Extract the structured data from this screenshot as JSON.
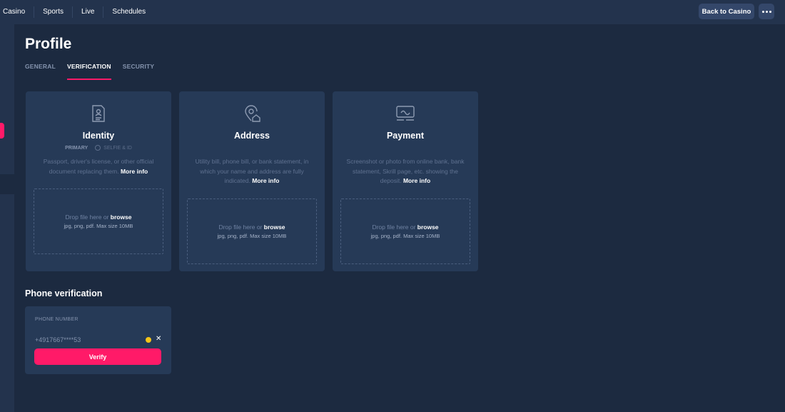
{
  "topnav": {
    "items": [
      "Casino",
      "Sports",
      "Live",
      "Schedules"
    ],
    "back_label": "Back to Casino"
  },
  "profile": {
    "title": "Profile",
    "tabs": [
      "GENERAL",
      "VERIFICATION",
      "SECURITY"
    ],
    "active_tab": "VERIFICATION"
  },
  "cards": [
    {
      "title": "Identity",
      "icon": "id-document-icon",
      "badge_primary": "PRIMARY",
      "badge_secondary": "SELFIE & ID",
      "desc": "Passport, driver's license, or other official document replacing them.",
      "more": "More info",
      "drop_text": "Drop file here or",
      "browse": "browse",
      "hint": "jpg, png, pdf. Max size 10MB"
    },
    {
      "title": "Address",
      "icon": "location-home-icon",
      "desc": "Utility bill, phone bill, or bank statement, in which your name and address are fully indicated.",
      "more": "More info",
      "drop_text": "Drop file here or",
      "browse": "browse",
      "hint": "jpg, png, pdf. Max size 10MB"
    },
    {
      "title": "Payment",
      "icon": "payment-card-icon",
      "desc": "Screenshot or photo from online bank, bank statement, Skrill page, etc. showing the deposit.",
      "more": "More info",
      "drop_text": "Drop file here or",
      "browse": "browse",
      "hint": "jpg, png, pdf. Max size 10MB"
    }
  ],
  "phone": {
    "section_title": "Phone verification",
    "label": "PHONE NUMBER",
    "number": "+4917667****53",
    "status_color": "#f5c518",
    "clear": "✕",
    "verify_label": "Verify"
  },
  "colors": {
    "accent": "#ff1a68",
    "background": "#1c2a40",
    "card": "#263a57"
  }
}
